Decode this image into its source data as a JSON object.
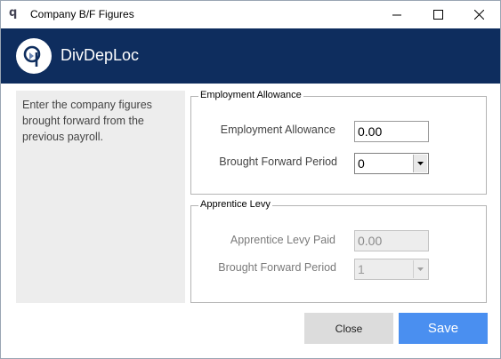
{
  "window": {
    "title": "Company B/F Figures",
    "app_icon": "q"
  },
  "header": {
    "app_name": "DivDepLoc",
    "colors": {
      "band": "#0e2d5e",
      "logo_bg": "#ffffff"
    }
  },
  "info": {
    "text": "Enter the company figures brought forward from the previous payroll."
  },
  "employment_allowance": {
    "legend": "Employment Allowance",
    "amount_label": "Employment Allowance",
    "amount_value": "0.00",
    "period_label": "Brought Forward Period",
    "period_value": "0"
  },
  "apprentice_levy": {
    "legend": "Apprentice Levy",
    "paid_label": "Apprentice Levy Paid",
    "paid_value": "0.00",
    "period_label": "Brought Forward Period",
    "period_value": "1"
  },
  "buttons": {
    "close_label": "Close",
    "save_label": "Save"
  },
  "colors": {
    "save_button": "#4a8ff0",
    "close_button": "#dcdcdc",
    "panel_bg": "#ededed"
  }
}
